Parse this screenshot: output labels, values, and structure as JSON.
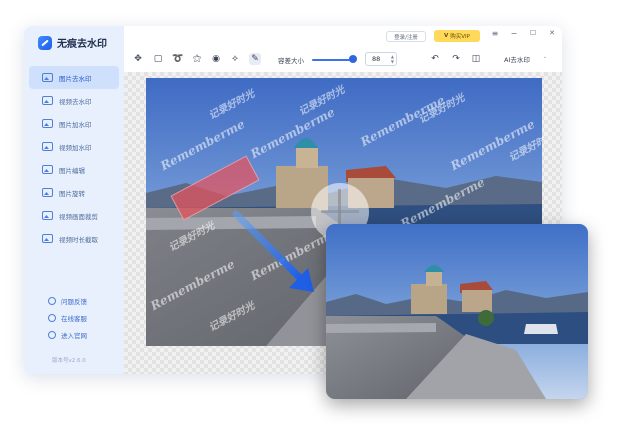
{
  "app": {
    "name": "无痕去水印",
    "version": "版本号v2.6.0"
  },
  "header": {
    "login_label": "登录/注册",
    "vip_label": "购买VIP",
    "vip_badge": "V"
  },
  "window_controls": {
    "menu": "≡",
    "minimize": "−",
    "maximize": "☐",
    "close": "✕"
  },
  "sidebar": {
    "items": [
      {
        "label": "图片去水印",
        "icon": "image-icon",
        "active": true
      },
      {
        "label": "视频去水印",
        "icon": "video-icon",
        "active": false
      },
      {
        "label": "图片加水印",
        "icon": "image-add-icon",
        "active": false
      },
      {
        "label": "视频加水印",
        "icon": "video-add-icon",
        "active": false
      },
      {
        "label": "图片编辑",
        "icon": "image-edit-icon",
        "active": false
      },
      {
        "label": "图片旋转",
        "icon": "rotate-icon",
        "active": false
      },
      {
        "label": "视频画面裁剪",
        "icon": "crop-icon",
        "active": false
      },
      {
        "label": "视频时长截取",
        "icon": "trim-icon",
        "active": false
      }
    ],
    "links": [
      {
        "label": "问题反馈",
        "icon": "feedback-icon"
      },
      {
        "label": "在线客服",
        "icon": "support-icon"
      },
      {
        "label": "进入官网",
        "icon": "website-icon"
      }
    ]
  },
  "toolbar": {
    "tools": [
      {
        "name": "move-tool-icon",
        "glyph": "✥"
      },
      {
        "name": "rect-select-icon",
        "glyph": "▢"
      },
      {
        "name": "lasso-icon",
        "glyph": "➰"
      },
      {
        "name": "magic-wand-icon",
        "glyph": "⚝"
      },
      {
        "name": "brush-select-icon",
        "glyph": "◉"
      },
      {
        "name": "smart-select-icon",
        "glyph": "⟡"
      },
      {
        "name": "eraser-brush-icon",
        "glyph": "✎"
      }
    ],
    "brush_size_label": "容差大小",
    "brush_size_value": "88",
    "stepper_up": "▲",
    "stepper_down": "▼",
    "actions": [
      {
        "name": "undo-icon",
        "glyph": "↶"
      },
      {
        "name": "redo-icon",
        "glyph": "↷"
      },
      {
        "name": "compare-icon",
        "glyph": "◫"
      }
    ],
    "ai_mode": "AI去水印",
    "ai_caret": "⌄"
  },
  "watermark": {
    "cn": "记录好时光",
    "en": "Rememberme"
  },
  "colors": {
    "accent": "#2f66e0",
    "sidebar_bg": "#e8f0fd",
    "vip": "#ffd95a",
    "selection": "#e8525c"
  }
}
